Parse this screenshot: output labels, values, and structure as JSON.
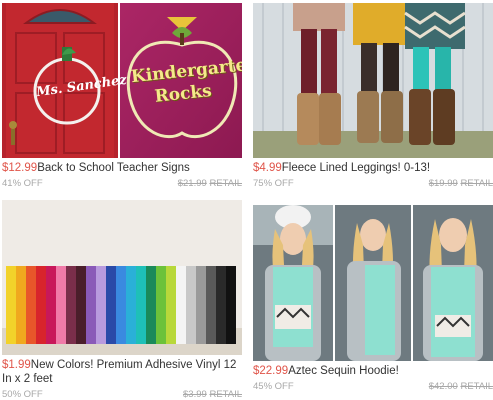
{
  "products": [
    {
      "price": "$12.99",
      "title": "Back to School Teacher Signs",
      "discount": "41% OFF",
      "retail_price": "$21.99",
      "retail_label": "RETAIL",
      "image_text_1": "Ms. Sanchez",
      "image_text_2": "Kindergarten Rocks"
    },
    {
      "price": "$4.99",
      "title": "Fleece Lined Leggings! 0-13!",
      "discount": "75% OFF",
      "retail_price": "$19.99",
      "retail_label": "RETAIL"
    },
    {
      "price": "$1.99",
      "title": "New Colors! Premium Adhesive Vinyl 12 In x 2 feet",
      "discount": "50% OFF",
      "retail_price": "$3.99",
      "retail_label": "RETAIL"
    },
    {
      "price": "$22.99",
      "title": "Aztec Sequin Hoodie!",
      "discount": "45% OFF",
      "retail_price": "$42.00",
      "retail_label": "RETAIL"
    }
  ]
}
